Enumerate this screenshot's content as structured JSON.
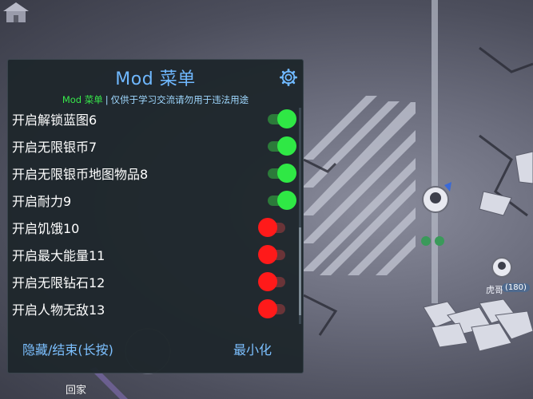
{
  "menu": {
    "title": "Mod 菜单",
    "subtitle_brand": "Mod 菜单",
    "subtitle_separator": "|",
    "subtitle_text": "仅供于学习交流请勿用于违法用途",
    "settings_icon": "gear-icon",
    "options": [
      {
        "label": "开启解锁蓝图6",
        "state": "on"
      },
      {
        "label": "开启无限银币7",
        "state": "on"
      },
      {
        "label": "开启无限银币地图物品8",
        "state": "on"
      },
      {
        "label": "开启耐力9",
        "state": "on"
      },
      {
        "label": "开启饥饿10",
        "state": "off"
      },
      {
        "label": "开启最大能量11",
        "state": "off"
      },
      {
        "label": "开启无限钻石12",
        "state": "off"
      },
      {
        "label": "开启人物无敌13",
        "state": "off"
      }
    ],
    "hide_label": "隐藏/结束(长按)",
    "minimize_label": "最小化",
    "colors": {
      "title": "#6fb8ff",
      "subtitle_brand": "#37e84a",
      "toggle_on": "#2fe845",
      "toggle_off": "#ff1a1a"
    }
  },
  "game": {
    "player_name": "虎哥",
    "player_level": "(180)",
    "home_label": "回家",
    "home_icon": "house-icon"
  }
}
